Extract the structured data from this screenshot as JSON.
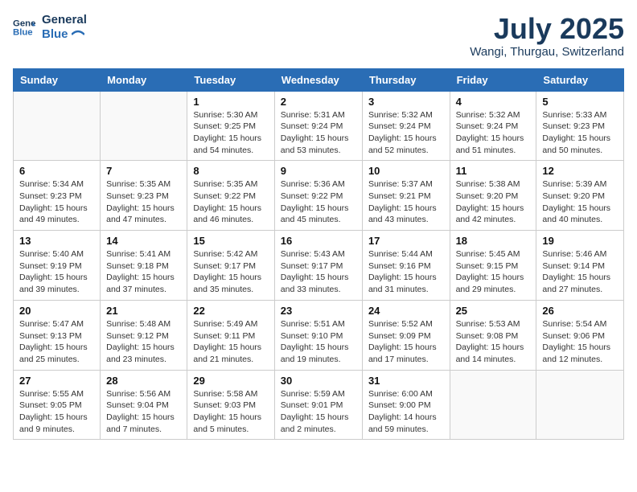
{
  "header": {
    "logo_line1": "General",
    "logo_line2": "Blue",
    "month_year": "July 2025",
    "location": "Wangi, Thurgau, Switzerland"
  },
  "weekdays": [
    "Sunday",
    "Monday",
    "Tuesday",
    "Wednesday",
    "Thursday",
    "Friday",
    "Saturday"
  ],
  "weeks": [
    [
      {
        "day": "",
        "sunrise": "",
        "sunset": "",
        "daylight": ""
      },
      {
        "day": "",
        "sunrise": "",
        "sunset": "",
        "daylight": ""
      },
      {
        "day": "1",
        "sunrise": "Sunrise: 5:30 AM",
        "sunset": "Sunset: 9:25 PM",
        "daylight": "Daylight: 15 hours and 54 minutes."
      },
      {
        "day": "2",
        "sunrise": "Sunrise: 5:31 AM",
        "sunset": "Sunset: 9:24 PM",
        "daylight": "Daylight: 15 hours and 53 minutes."
      },
      {
        "day": "3",
        "sunrise": "Sunrise: 5:32 AM",
        "sunset": "Sunset: 9:24 PM",
        "daylight": "Daylight: 15 hours and 52 minutes."
      },
      {
        "day": "4",
        "sunrise": "Sunrise: 5:32 AM",
        "sunset": "Sunset: 9:24 PM",
        "daylight": "Daylight: 15 hours and 51 minutes."
      },
      {
        "day": "5",
        "sunrise": "Sunrise: 5:33 AM",
        "sunset": "Sunset: 9:23 PM",
        "daylight": "Daylight: 15 hours and 50 minutes."
      }
    ],
    [
      {
        "day": "6",
        "sunrise": "Sunrise: 5:34 AM",
        "sunset": "Sunset: 9:23 PM",
        "daylight": "Daylight: 15 hours and 49 minutes."
      },
      {
        "day": "7",
        "sunrise": "Sunrise: 5:35 AM",
        "sunset": "Sunset: 9:23 PM",
        "daylight": "Daylight: 15 hours and 47 minutes."
      },
      {
        "day": "8",
        "sunrise": "Sunrise: 5:35 AM",
        "sunset": "Sunset: 9:22 PM",
        "daylight": "Daylight: 15 hours and 46 minutes."
      },
      {
        "day": "9",
        "sunrise": "Sunrise: 5:36 AM",
        "sunset": "Sunset: 9:22 PM",
        "daylight": "Daylight: 15 hours and 45 minutes."
      },
      {
        "day": "10",
        "sunrise": "Sunrise: 5:37 AM",
        "sunset": "Sunset: 9:21 PM",
        "daylight": "Daylight: 15 hours and 43 minutes."
      },
      {
        "day": "11",
        "sunrise": "Sunrise: 5:38 AM",
        "sunset": "Sunset: 9:20 PM",
        "daylight": "Daylight: 15 hours and 42 minutes."
      },
      {
        "day": "12",
        "sunrise": "Sunrise: 5:39 AM",
        "sunset": "Sunset: 9:20 PM",
        "daylight": "Daylight: 15 hours and 40 minutes."
      }
    ],
    [
      {
        "day": "13",
        "sunrise": "Sunrise: 5:40 AM",
        "sunset": "Sunset: 9:19 PM",
        "daylight": "Daylight: 15 hours and 39 minutes."
      },
      {
        "day": "14",
        "sunrise": "Sunrise: 5:41 AM",
        "sunset": "Sunset: 9:18 PM",
        "daylight": "Daylight: 15 hours and 37 minutes."
      },
      {
        "day": "15",
        "sunrise": "Sunrise: 5:42 AM",
        "sunset": "Sunset: 9:17 PM",
        "daylight": "Daylight: 15 hours and 35 minutes."
      },
      {
        "day": "16",
        "sunrise": "Sunrise: 5:43 AM",
        "sunset": "Sunset: 9:17 PM",
        "daylight": "Daylight: 15 hours and 33 minutes."
      },
      {
        "day": "17",
        "sunrise": "Sunrise: 5:44 AM",
        "sunset": "Sunset: 9:16 PM",
        "daylight": "Daylight: 15 hours and 31 minutes."
      },
      {
        "day": "18",
        "sunrise": "Sunrise: 5:45 AM",
        "sunset": "Sunset: 9:15 PM",
        "daylight": "Daylight: 15 hours and 29 minutes."
      },
      {
        "day": "19",
        "sunrise": "Sunrise: 5:46 AM",
        "sunset": "Sunset: 9:14 PM",
        "daylight": "Daylight: 15 hours and 27 minutes."
      }
    ],
    [
      {
        "day": "20",
        "sunrise": "Sunrise: 5:47 AM",
        "sunset": "Sunset: 9:13 PM",
        "daylight": "Daylight: 15 hours and 25 minutes."
      },
      {
        "day": "21",
        "sunrise": "Sunrise: 5:48 AM",
        "sunset": "Sunset: 9:12 PM",
        "daylight": "Daylight: 15 hours and 23 minutes."
      },
      {
        "day": "22",
        "sunrise": "Sunrise: 5:49 AM",
        "sunset": "Sunset: 9:11 PM",
        "daylight": "Daylight: 15 hours and 21 minutes."
      },
      {
        "day": "23",
        "sunrise": "Sunrise: 5:51 AM",
        "sunset": "Sunset: 9:10 PM",
        "daylight": "Daylight: 15 hours and 19 minutes."
      },
      {
        "day": "24",
        "sunrise": "Sunrise: 5:52 AM",
        "sunset": "Sunset: 9:09 PM",
        "daylight": "Daylight: 15 hours and 17 minutes."
      },
      {
        "day": "25",
        "sunrise": "Sunrise: 5:53 AM",
        "sunset": "Sunset: 9:08 PM",
        "daylight": "Daylight: 15 hours and 14 minutes."
      },
      {
        "day": "26",
        "sunrise": "Sunrise: 5:54 AM",
        "sunset": "Sunset: 9:06 PM",
        "daylight": "Daylight: 15 hours and 12 minutes."
      }
    ],
    [
      {
        "day": "27",
        "sunrise": "Sunrise: 5:55 AM",
        "sunset": "Sunset: 9:05 PM",
        "daylight": "Daylight: 15 hours and 9 minutes."
      },
      {
        "day": "28",
        "sunrise": "Sunrise: 5:56 AM",
        "sunset": "Sunset: 9:04 PM",
        "daylight": "Daylight: 15 hours and 7 minutes."
      },
      {
        "day": "29",
        "sunrise": "Sunrise: 5:58 AM",
        "sunset": "Sunset: 9:03 PM",
        "daylight": "Daylight: 15 hours and 5 minutes."
      },
      {
        "day": "30",
        "sunrise": "Sunrise: 5:59 AM",
        "sunset": "Sunset: 9:01 PM",
        "daylight": "Daylight: 15 hours and 2 minutes."
      },
      {
        "day": "31",
        "sunrise": "Sunrise: 6:00 AM",
        "sunset": "Sunset: 9:00 PM",
        "daylight": "Daylight: 14 hours and 59 minutes."
      },
      {
        "day": "",
        "sunrise": "",
        "sunset": "",
        "daylight": ""
      },
      {
        "day": "",
        "sunrise": "",
        "sunset": "",
        "daylight": ""
      }
    ]
  ]
}
